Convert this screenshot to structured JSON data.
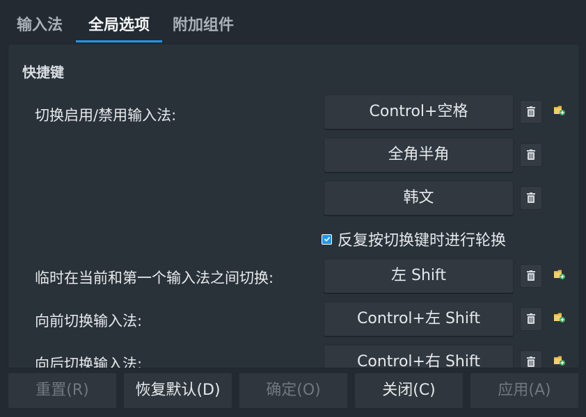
{
  "tabs": [
    {
      "label": "输入法"
    },
    {
      "label": "全局选项"
    },
    {
      "label": "附加组件"
    }
  ],
  "shortcuts": {
    "section_title": "快捷键",
    "toggle_label": "切换启用/禁用输入法:",
    "toggle_keys": [
      "Control+空格",
      "全角半角",
      "韩文"
    ],
    "cycle_checkbox_label": "反复按切换键时进行轮换",
    "cycle_checked": true,
    "temp_switch_label": "临时在当前和第一个输入法之间切换:",
    "temp_switch_key": "左 Shift",
    "forward_label": "向前切换输入法:",
    "forward_key": "Control+左 Shift",
    "backward_label": "向后切换输入法:",
    "backward_key": "Control+右 Shift"
  },
  "footer": {
    "reset": "重置(R)",
    "restore_defaults": "恢复默认(D)",
    "ok": "确定(O)",
    "close": "关闭(C)",
    "apply": "应用(A)"
  },
  "colors": {
    "accent": "#1d99f3",
    "background": "#232a31",
    "panel": "#2a3239"
  }
}
